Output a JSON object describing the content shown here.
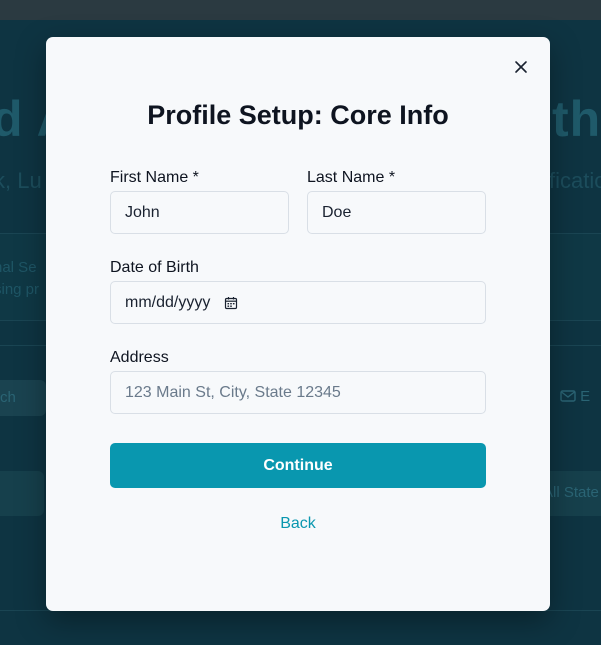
{
  "background": {
    "hero_title_left": "d A",
    "hero_title_right": "thi",
    "hero_sub_left": "k, Lu",
    "hero_sub_right": "ficatio",
    "card_line1": "nal Se",
    "card_line2": "sing pr",
    "search_fragment": "ch",
    "email_fragment": "E",
    "filter_fragment": "All State"
  },
  "modal": {
    "title": "Profile Setup: Core Info",
    "first_name": {
      "label": "First Name *",
      "value": "John"
    },
    "last_name": {
      "label": "Last Name *",
      "value": "Doe"
    },
    "dob": {
      "label": "Date of Birth",
      "placeholder": "mm/dd/yyyy"
    },
    "address": {
      "label": "Address",
      "placeholder": "123 Main St, City, State 12345"
    },
    "continue_label": "Continue",
    "back_label": "Back"
  },
  "colors": {
    "accent": "#0997af",
    "modal_bg": "#f7f9fb",
    "overlay_bg": "#0e3442"
  },
  "icons": {
    "close": "close-icon",
    "calendar": "calendar-icon",
    "mail": "mail-icon"
  }
}
